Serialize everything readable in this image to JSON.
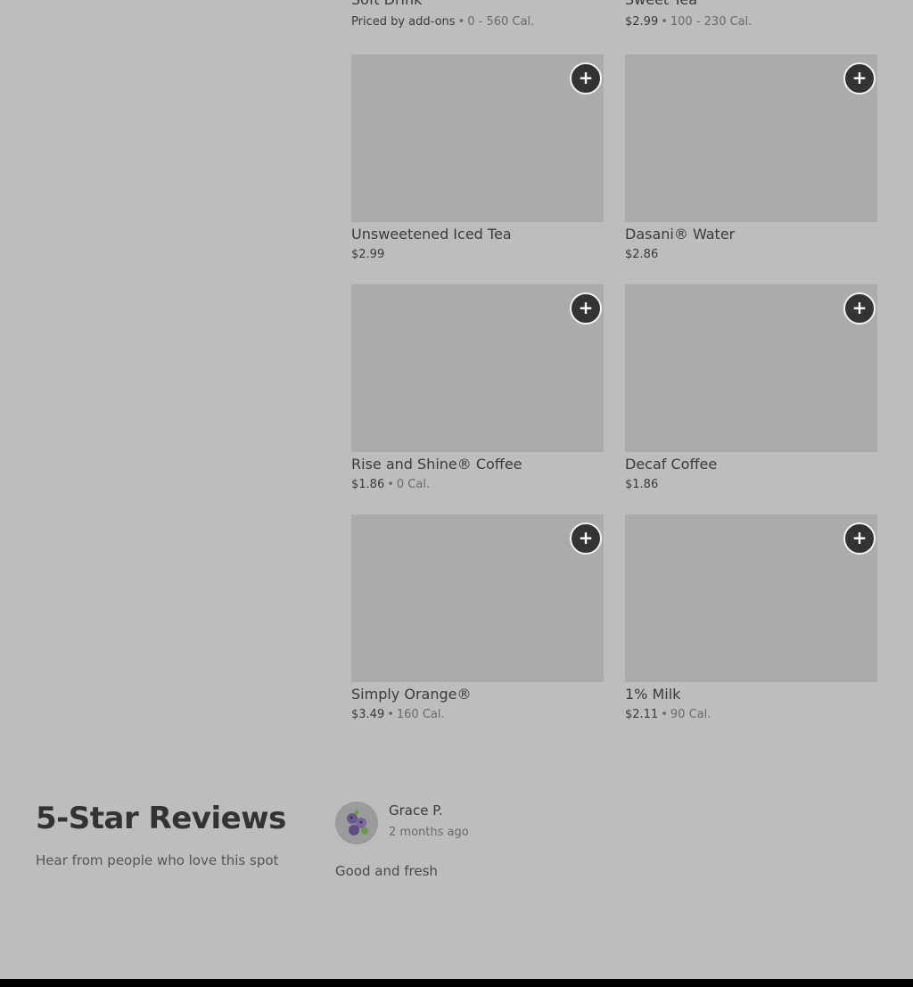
{
  "top_items": [
    {
      "name": "Soft Drink",
      "price": "Priced by add-ons",
      "calories": "0 - 560 Cal."
    },
    {
      "name": "Sweet Tea",
      "price": "$2.99",
      "calories": "100 - 230 Cal."
    }
  ],
  "menu_items": [
    {
      "name": "Unsweetened Iced Tea",
      "price": "$2.99",
      "calories": ""
    },
    {
      "name": "Dasani® Water",
      "price": "$2.86",
      "calories": ""
    },
    {
      "name": "Rise and Shine® Coffee",
      "price": "$1.86",
      "calories": "0 Cal."
    },
    {
      "name": "Decaf Coffee",
      "price": "$1.86",
      "calories": ""
    },
    {
      "name": "Simply Orange®",
      "price": "$3.49",
      "calories": "160 Cal."
    },
    {
      "name": "1% Milk",
      "price": "$2.11",
      "calories": "90 Cal."
    }
  ],
  "add_button_label": "+",
  "separator": "•",
  "reviews": {
    "title": "5-Star Reviews",
    "subtitle": "Hear from people who love this spot",
    "items": [
      {
        "reviewer": "Grace P.",
        "date": "2 months ago",
        "text": "Good and fresh",
        "avatar_icon": "blueberry-avatar-icon"
      }
    ]
  },
  "colors": {
    "background": "#bdbdbd",
    "image_placeholder": "#ababab",
    "add_button": "#333333"
  }
}
